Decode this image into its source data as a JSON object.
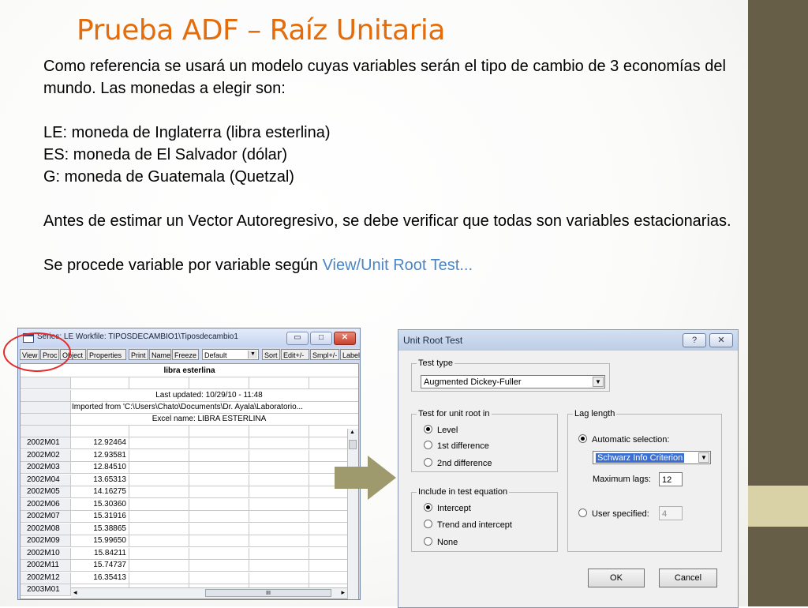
{
  "slide": {
    "title": "Prueba ADF – Raíz Unitaria",
    "para1": "Como referencia se usará un modelo cuyas variables serán el tipo de cambio de 3 economías del mundo. Las monedas a elegir son:",
    "le": "LE: moneda de Inglaterra (libra esterlina)",
    "es": "ES: moneda de El Salvador (dólar)",
    "g": "G: moneda de Guatemala (Quetzal)",
    "para2": "Antes de estimar un Vector Autoregresivo, se debe verificar que todas son variables estacionarias.",
    "para3_prefix": "Se procede variable por variable según ",
    "para3_link": "View/Unit Root Test...",
    "colors": {
      "title": "#e46c0a",
      "link": "#4a86c5",
      "sidebar": "#675e47",
      "accent": "#d9d2a6"
    }
  },
  "series_window": {
    "title": "Series: LE   Workfile: TIPOSDECAMBIO1\\Tiposdecambio1",
    "title_buttons": [
      "▭",
      "□",
      "✕"
    ],
    "toolbar": [
      "View",
      "Proc",
      "Object",
      "Properties",
      "Print",
      "Name",
      "Freeze",
      "Default",
      "Sort",
      "Edit+/-",
      "Smpl+/-",
      "Label"
    ],
    "series_label": "libra esterlina",
    "last_updated": "Last updated: 10/29/10 - 11:48",
    "imported_from": "Imported from 'C:\\Users\\Chato\\Documents\\Dr. Ayala\\Laboratorio...",
    "excel_name": "Excel name: LIBRA ESTERLINA",
    "rows": [
      {
        "obs": "2002M01",
        "value": "12.92464"
      },
      {
        "obs": "2002M02",
        "value": "12.93581"
      },
      {
        "obs": "2002M03",
        "value": "12.84510"
      },
      {
        "obs": "2002M04",
        "value": "13.65313"
      },
      {
        "obs": "2002M05",
        "value": "14.16275"
      },
      {
        "obs": "2002M06",
        "value": "15.30360"
      },
      {
        "obs": "2002M07",
        "value": "15.31916"
      },
      {
        "obs": "2002M08",
        "value": "15.38865"
      },
      {
        "obs": "2002M09",
        "value": "15.99650"
      },
      {
        "obs": "2002M10",
        "value": "15.84211"
      },
      {
        "obs": "2002M11",
        "value": "15.74737"
      },
      {
        "obs": "2002M12",
        "value": "16.35413"
      },
      {
        "obs": "2003M01",
        "value": ""
      }
    ],
    "scroll_glyphs": {
      "up": "▲",
      "down": "▼",
      "left": "◂",
      "right": "▸",
      "grip": "III"
    }
  },
  "dialog": {
    "title": "Unit Root Test",
    "help_button": "?",
    "close_button": "✕",
    "test_type_legend": "Test type",
    "test_type_value": "Augmented Dickey-Fuller",
    "unit_root_legend": "Test for unit root in",
    "unit_root_options": [
      "Level",
      "1st difference",
      "2nd difference"
    ],
    "unit_root_selected": 0,
    "include_legend": "Include in test equation",
    "include_options": [
      "Intercept",
      "Trend and intercept",
      "None"
    ],
    "include_selected": 0,
    "lag_legend": "Lag length",
    "auto_selection_label": "Automatic selection:",
    "criterion_value": "Schwarz Info Criterion",
    "max_lags_label": "Maximum lags:",
    "max_lags_value": "12",
    "user_specified_label": "User specified:",
    "user_specified_value": "4",
    "ok_label": "OK",
    "cancel_label": "Cancel",
    "combo_arrow": "▼"
  }
}
